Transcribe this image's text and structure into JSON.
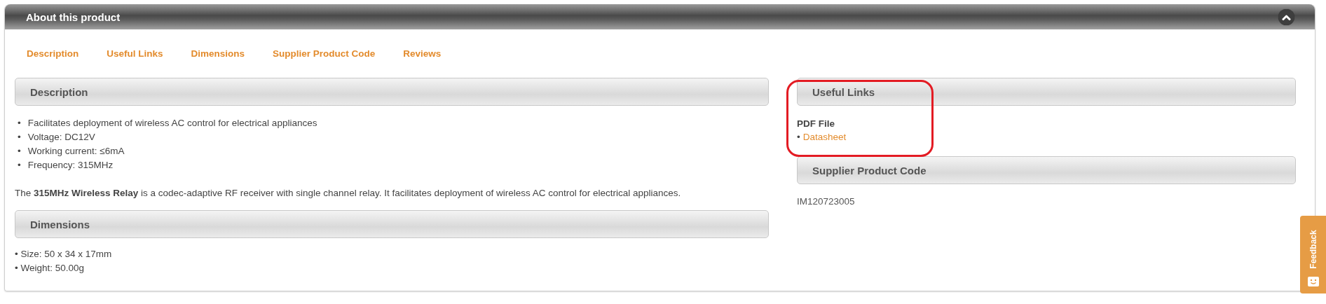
{
  "panel": {
    "title": "About this product"
  },
  "tabs": [
    "Description",
    "Useful Links",
    "Dimensions",
    "Supplier Product Code",
    "Reviews"
  ],
  "description": {
    "heading": "Description",
    "bullet": "•",
    "bullets": [
      "Facilitates deployment of wireless AC control for electrical appliances",
      "Voltage: DC12V",
      "Working current: ≤6mA",
      "Frequency: 315MHz"
    ],
    "paragraph": "The **315MHz Wireless Relay** is a codec-adaptive RF receiver with single channel relay. It facilitates deployment of wireless AC control for electrical appliances."
  },
  "dimensions": {
    "heading": "Dimensions",
    "lines": [
      "• Size: 50 x 34 x 17mm",
      "• Weight: 50.00g"
    ]
  },
  "useful_links": {
    "heading": "Useful Links",
    "group_label": "PDF File",
    "bullet": "•",
    "link": "Datasheet",
    "highlighted": true
  },
  "supplier_product_code": {
    "heading": "Supplier Product Code",
    "value": "IM120723005"
  },
  "feedback_tab": {
    "label": "Feedback"
  }
}
